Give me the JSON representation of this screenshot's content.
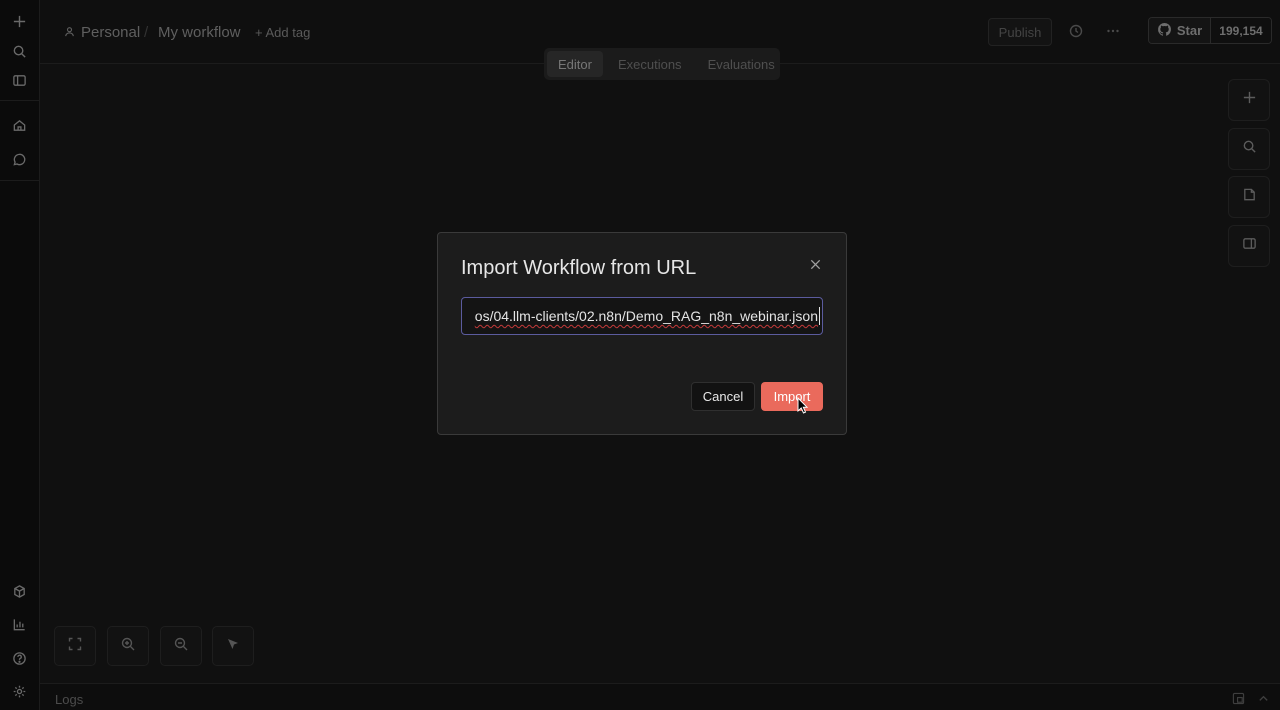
{
  "breadcrumb": {
    "project": "Personal",
    "workflow": "My workflow",
    "add_tag": "+ Add tag"
  },
  "header": {
    "publish_label": "Publish",
    "github_star_label": "Star",
    "github_star_count": "199,154"
  },
  "tabs": [
    {
      "label": "Editor",
      "active": true
    },
    {
      "label": "Executions",
      "active": false
    },
    {
      "label": "Evaluations",
      "active": false
    }
  ],
  "modal": {
    "title": "Import Workflow from URL",
    "url_value": "os/04.llm-clients/02.n8n/Demo_RAG_n8n_webinar.json",
    "cancel_label": "Cancel",
    "import_label": "Import"
  },
  "logs": {
    "label": "Logs"
  },
  "colors": {
    "accent": "#ea6a5c",
    "input_focus_border": "#5b5b9e",
    "background": "#101010"
  }
}
